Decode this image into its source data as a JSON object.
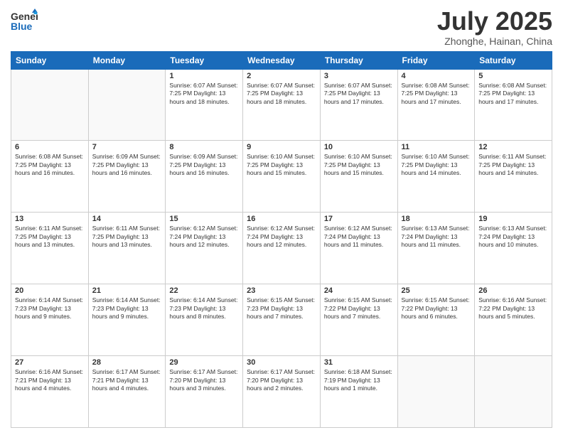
{
  "header": {
    "logo_general": "General",
    "logo_blue": "Blue",
    "title": "July 2025",
    "location": "Zhonghe, Hainan, China"
  },
  "weekdays": [
    "Sunday",
    "Monday",
    "Tuesday",
    "Wednesday",
    "Thursday",
    "Friday",
    "Saturday"
  ],
  "weeks": [
    [
      {
        "day": "",
        "info": ""
      },
      {
        "day": "",
        "info": ""
      },
      {
        "day": "1",
        "info": "Sunrise: 6:07 AM\nSunset: 7:25 PM\nDaylight: 13 hours and 18 minutes."
      },
      {
        "day": "2",
        "info": "Sunrise: 6:07 AM\nSunset: 7:25 PM\nDaylight: 13 hours and 18 minutes."
      },
      {
        "day": "3",
        "info": "Sunrise: 6:07 AM\nSunset: 7:25 PM\nDaylight: 13 hours and 17 minutes."
      },
      {
        "day": "4",
        "info": "Sunrise: 6:08 AM\nSunset: 7:25 PM\nDaylight: 13 hours and 17 minutes."
      },
      {
        "day": "5",
        "info": "Sunrise: 6:08 AM\nSunset: 7:25 PM\nDaylight: 13 hours and 17 minutes."
      }
    ],
    [
      {
        "day": "6",
        "info": "Sunrise: 6:08 AM\nSunset: 7:25 PM\nDaylight: 13 hours and 16 minutes."
      },
      {
        "day": "7",
        "info": "Sunrise: 6:09 AM\nSunset: 7:25 PM\nDaylight: 13 hours and 16 minutes."
      },
      {
        "day": "8",
        "info": "Sunrise: 6:09 AM\nSunset: 7:25 PM\nDaylight: 13 hours and 16 minutes."
      },
      {
        "day": "9",
        "info": "Sunrise: 6:10 AM\nSunset: 7:25 PM\nDaylight: 13 hours and 15 minutes."
      },
      {
        "day": "10",
        "info": "Sunrise: 6:10 AM\nSunset: 7:25 PM\nDaylight: 13 hours and 15 minutes."
      },
      {
        "day": "11",
        "info": "Sunrise: 6:10 AM\nSunset: 7:25 PM\nDaylight: 13 hours and 14 minutes."
      },
      {
        "day": "12",
        "info": "Sunrise: 6:11 AM\nSunset: 7:25 PM\nDaylight: 13 hours and 14 minutes."
      }
    ],
    [
      {
        "day": "13",
        "info": "Sunrise: 6:11 AM\nSunset: 7:25 PM\nDaylight: 13 hours and 13 minutes."
      },
      {
        "day": "14",
        "info": "Sunrise: 6:11 AM\nSunset: 7:25 PM\nDaylight: 13 hours and 13 minutes."
      },
      {
        "day": "15",
        "info": "Sunrise: 6:12 AM\nSunset: 7:24 PM\nDaylight: 13 hours and 12 minutes."
      },
      {
        "day": "16",
        "info": "Sunrise: 6:12 AM\nSunset: 7:24 PM\nDaylight: 13 hours and 12 minutes."
      },
      {
        "day": "17",
        "info": "Sunrise: 6:12 AM\nSunset: 7:24 PM\nDaylight: 13 hours and 11 minutes."
      },
      {
        "day": "18",
        "info": "Sunrise: 6:13 AM\nSunset: 7:24 PM\nDaylight: 13 hours and 11 minutes."
      },
      {
        "day": "19",
        "info": "Sunrise: 6:13 AM\nSunset: 7:24 PM\nDaylight: 13 hours and 10 minutes."
      }
    ],
    [
      {
        "day": "20",
        "info": "Sunrise: 6:14 AM\nSunset: 7:23 PM\nDaylight: 13 hours and 9 minutes."
      },
      {
        "day": "21",
        "info": "Sunrise: 6:14 AM\nSunset: 7:23 PM\nDaylight: 13 hours and 9 minutes."
      },
      {
        "day": "22",
        "info": "Sunrise: 6:14 AM\nSunset: 7:23 PM\nDaylight: 13 hours and 8 minutes."
      },
      {
        "day": "23",
        "info": "Sunrise: 6:15 AM\nSunset: 7:23 PM\nDaylight: 13 hours and 7 minutes."
      },
      {
        "day": "24",
        "info": "Sunrise: 6:15 AM\nSunset: 7:22 PM\nDaylight: 13 hours and 7 minutes."
      },
      {
        "day": "25",
        "info": "Sunrise: 6:15 AM\nSunset: 7:22 PM\nDaylight: 13 hours and 6 minutes."
      },
      {
        "day": "26",
        "info": "Sunrise: 6:16 AM\nSunset: 7:22 PM\nDaylight: 13 hours and 5 minutes."
      }
    ],
    [
      {
        "day": "27",
        "info": "Sunrise: 6:16 AM\nSunset: 7:21 PM\nDaylight: 13 hours and 4 minutes."
      },
      {
        "day": "28",
        "info": "Sunrise: 6:17 AM\nSunset: 7:21 PM\nDaylight: 13 hours and 4 minutes."
      },
      {
        "day": "29",
        "info": "Sunrise: 6:17 AM\nSunset: 7:20 PM\nDaylight: 13 hours and 3 minutes."
      },
      {
        "day": "30",
        "info": "Sunrise: 6:17 AM\nSunset: 7:20 PM\nDaylight: 13 hours and 2 minutes."
      },
      {
        "day": "31",
        "info": "Sunrise: 6:18 AM\nSunset: 7:19 PM\nDaylight: 13 hours and 1 minute."
      },
      {
        "day": "",
        "info": ""
      },
      {
        "day": "",
        "info": ""
      }
    ]
  ]
}
